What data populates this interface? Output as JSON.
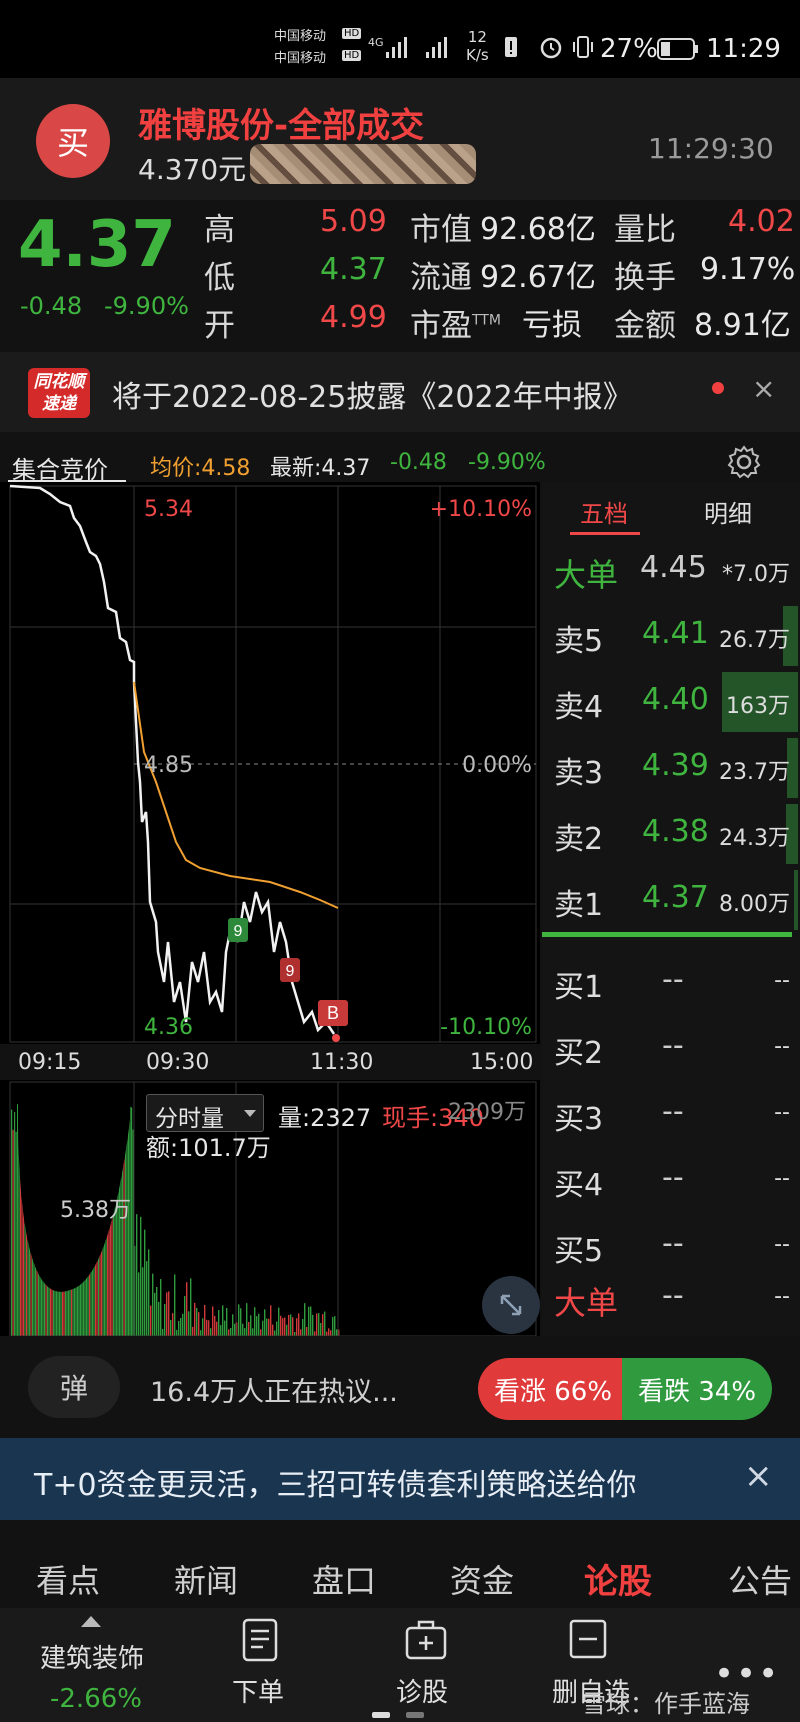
{
  "status_bar": {
    "carrier1": "中国移动",
    "carrier2": "中国移动",
    "hd": "HD",
    "net": "4G",
    "speed_value": "12",
    "speed_unit": "K/s",
    "battery": "27%",
    "time": "11:29"
  },
  "header": {
    "buy_label": "买",
    "title": "雅博股份-全部成交",
    "price_line": "4.370元",
    "time": "11:29:30"
  },
  "quote": {
    "price": "4.37",
    "change": "-0.48",
    "change_pct": "-9.90%",
    "stats": [
      {
        "label": "高",
        "value": "5.09",
        "color": "#f04848"
      },
      {
        "label": "低",
        "value": "4.37",
        "color": "#3fb53f"
      },
      {
        "label": "开",
        "value": "4.99",
        "color": "#f04848"
      }
    ],
    "stats2": [
      {
        "label": "市值",
        "value": "92.68亿"
      },
      {
        "label": "流通",
        "value": "92.67亿"
      },
      {
        "label": "市盈",
        "sup": "TTM",
        "value": "亏损"
      }
    ],
    "stats3": [
      {
        "label": "量比",
        "value": "4.02",
        "color": "#f04848"
      },
      {
        "label": "换手",
        "value": "9.17%",
        "color": "#e6e6e6"
      },
      {
        "label": "金额",
        "value": "8.91亿",
        "color": "#e6e6e6"
      }
    ]
  },
  "news": {
    "logo_line1": "同花顺",
    "logo_line2": "速递",
    "text": "将于2022-08-25披露《2022年中报》",
    "close": "×"
  },
  "chart_info": {
    "mode": "集合竞价",
    "avg": "均价:4.58",
    "latest": "最新:4.37",
    "chg": "-0.48",
    "chg_pct": "-9.90%"
  },
  "chart_data": {
    "type": "line",
    "top_price": "5.34",
    "top_pct": "+10.10%",
    "mid_price": "4.85",
    "mid_pct": "0.00%",
    "bottom_price": "4.36",
    "bottom_pct": "-10.10%",
    "x_ticks": [
      "09:15",
      "09:30",
      "11:30",
      "15:00"
    ],
    "markers": [
      "9",
      "9",
      "B"
    ],
    "volume_label": "分时量",
    "volume": "量:2327",
    "now_hand": "现手:340",
    "volume_right": "2309万",
    "amount": "额:101.7万",
    "vol_scale": "5.38万"
  },
  "orderbook": {
    "tab_active": "五档",
    "tab_other": "明细",
    "top": {
      "label": "大单",
      "price": "4.45",
      "vol": "*7.0万"
    },
    "sells": [
      {
        "label": "卖5",
        "price": "4.41",
        "vol": "26.7万"
      },
      {
        "label": "卖4",
        "price": "4.40",
        "vol": "163万"
      },
      {
        "label": "卖3",
        "price": "4.39",
        "vol": "23.7万"
      },
      {
        "label": "卖2",
        "price": "4.38",
        "vol": "24.3万"
      },
      {
        "label": "卖1",
        "price": "4.37",
        "vol": "8.00万"
      }
    ],
    "buys": [
      {
        "label": "买1",
        "price": "--",
        "vol": "--"
      },
      {
        "label": "买2",
        "price": "--",
        "vol": "--"
      },
      {
        "label": "买3",
        "price": "--",
        "vol": "--"
      },
      {
        "label": "买4",
        "price": "--",
        "vol": "--"
      },
      {
        "label": "买5",
        "price": "--",
        "vol": "--"
      }
    ],
    "bottom": {
      "label": "大单",
      "price": "--",
      "vol": "--"
    }
  },
  "sentiment": {
    "bomb": "弹",
    "hot_text": "16.4万人正在热议...",
    "bull": "看涨 66%",
    "bear": "看跌 34%"
  },
  "promo": {
    "text": "T+0资金更灵活，三招可转债套利策略送给你",
    "close": "×"
  },
  "tabs": [
    "看点",
    "新闻",
    "盘口",
    "资金",
    "论股",
    "公告"
  ],
  "bottom_bar": {
    "sector": "建筑装饰",
    "sector_chg": "-2.66%",
    "order": "下单",
    "diagnose": "诊股",
    "delete": "删自选",
    "watermark": "雪球：作手蓝海"
  }
}
